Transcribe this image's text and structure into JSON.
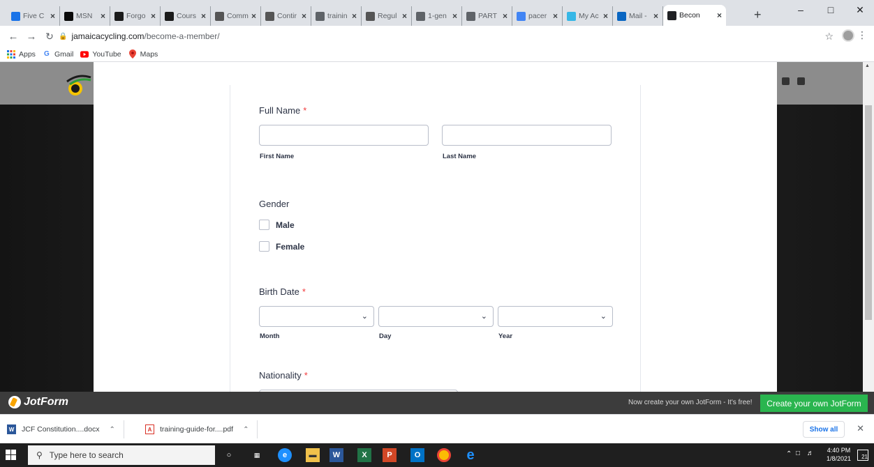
{
  "browser": {
    "tabs": [
      {
        "title": "Five C",
        "icon": "five-c-icon",
        "color": "#1a73e8"
      },
      {
        "title": "MSN",
        "icon": "msn-icon",
        "color": "#0a0a0a"
      },
      {
        "title": "Forgo",
        "icon": "uci-icon",
        "color": "#1b1b1b"
      },
      {
        "title": "Cours",
        "icon": "uci-icon",
        "color": "#1b1b1b"
      },
      {
        "title": "Comm",
        "icon": "uci-icon",
        "color": "#555555"
      },
      {
        "title": "Contir",
        "icon": "uci-icon",
        "color": "#555555"
      },
      {
        "title": "trainin",
        "icon": "globe-icon",
        "color": "#5f6368"
      },
      {
        "title": "Regul",
        "icon": "uci-icon",
        "color": "#555555"
      },
      {
        "title": "1-gen",
        "icon": "globe-icon",
        "color": "#5f6368"
      },
      {
        "title": "PART",
        "icon": "globe-icon",
        "color": "#5f6368"
      },
      {
        "title": "pacer",
        "icon": "google-icon",
        "color": "#4285f4"
      },
      {
        "title": "My Ac",
        "icon": "account-icon",
        "color": "#36b7e6"
      },
      {
        "title": "Mail -",
        "icon": "outlook-icon",
        "color": "#0a66c2"
      },
      {
        "title": "Becon",
        "icon": "jcf-icon",
        "color": "#202124"
      }
    ],
    "new_tab": "+",
    "url_host": "jamaicacycling.com",
    "url_path": "/become-a-member/",
    "bookmarks": [
      {
        "label": "Apps",
        "icon": "apps-grid-icon"
      },
      {
        "label": "Gmail",
        "icon": "gmail-icon"
      },
      {
        "label": "YouTube",
        "icon": "youtube-icon"
      },
      {
        "label": "Maps",
        "icon": "maps-icon"
      }
    ]
  },
  "form": {
    "full_name": {
      "label": "Full Name",
      "required": "*",
      "first_sublabel": "First Name",
      "last_sublabel": "Last Name",
      "first_value": "",
      "last_value": ""
    },
    "gender": {
      "label": "Gender",
      "options": [
        "Male",
        "Female"
      ]
    },
    "birth_date": {
      "label": "Birth Date",
      "required": "*",
      "month_sublabel": "Month",
      "day_sublabel": "Day",
      "year_sublabel": "Year"
    },
    "nationality": {
      "label": "Nationality",
      "required": "*"
    }
  },
  "jotform_bar": {
    "logo": "JotForm",
    "promo_text": "Now create your own JotForm - It's free!",
    "cta": "Create your own JotForm",
    "cta_color": "#2ab54f"
  },
  "downloads": {
    "items": [
      {
        "name": "JCF Constitution....docx",
        "icon": "word-doc-icon"
      },
      {
        "name": "training-guide-for....pdf",
        "icon": "pdf-icon"
      }
    ],
    "show_all": "Show all"
  },
  "taskbar": {
    "search_placeholder": "Type here to search",
    "time": "4:40 PM",
    "date": "1/8/2021",
    "notifications": "21"
  }
}
